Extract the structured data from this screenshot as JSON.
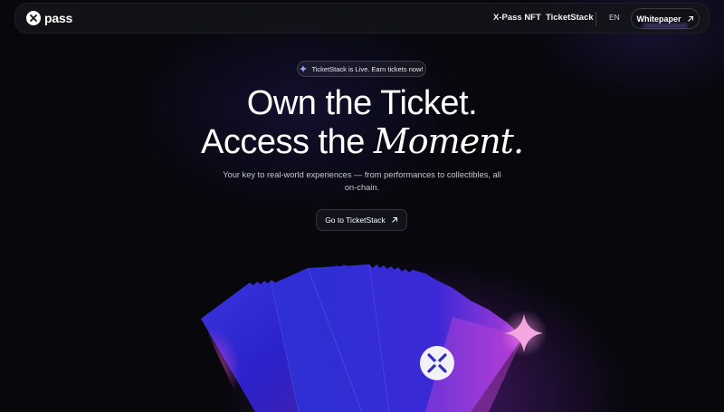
{
  "nav": {
    "brand": "pass",
    "links": [
      "X-Pass NFT",
      "TicketStack"
    ],
    "lang": "EN",
    "whitepaper_label": "Whitepaper"
  },
  "hero": {
    "badge": "TicketStack is Live. Earn tickets now!",
    "headline_line1": "Own the Ticket.",
    "headline_line2_plain": "Access the ",
    "headline_line2_italic": "Moment.",
    "subtitle": "Your key to real-world experiences — from performances to collectibles, all on-chain.",
    "cta_label": "Go to TicketStack"
  },
  "icons": {
    "brand": "x-pass-logo-icon",
    "external": "arrow-up-right-icon",
    "badge": "sparkle-icon",
    "ticket_logo": "x-pass-logo-icon",
    "star": "sparkle-icon"
  },
  "colors": {
    "background": "#07070c",
    "ticket_blue": "#2c2fd0",
    "ticket_purple": "#8a2be2",
    "sparkle": "#f4a6e0"
  }
}
